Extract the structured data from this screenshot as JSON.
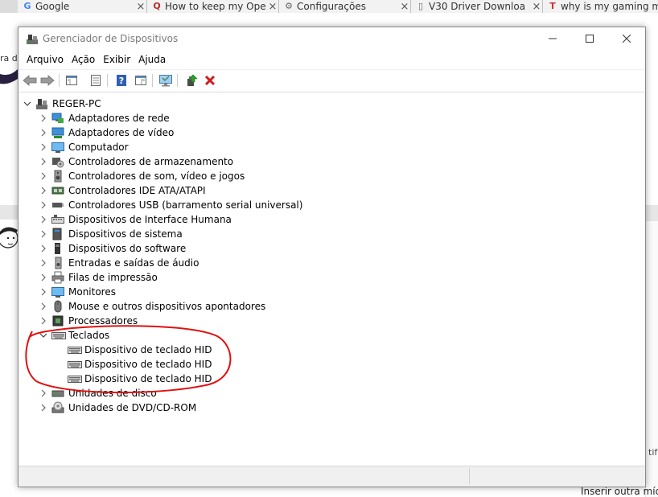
{
  "browser_tabs": [
    {
      "label": "Google",
      "icon": "google-icon"
    },
    {
      "label": "How to keep my Ope",
      "icon": "quora-icon"
    },
    {
      "label": "Configurações",
      "icon": "gear-icon"
    },
    {
      "label": "V30 Driver Downloa",
      "icon": "page-icon"
    },
    {
      "label": "why is my gaming m",
      "icon": "t-icon"
    }
  ],
  "background": {
    "left_text": "ra de",
    "right_text": "tif",
    "bottom_text": "Inserir outra mídia"
  },
  "window": {
    "title": "Gerenciador de Dispositivos",
    "minimize": "—",
    "maximize": "☐",
    "close": "✕"
  },
  "menu": [
    "Arquivo",
    "Ação",
    "Exibir",
    "Ajuda"
  ],
  "toolbar": [
    "back",
    "forward",
    "properties-view",
    "list-view",
    "help",
    "details-view",
    "monitor-scan",
    "update-driver",
    "uninstall"
  ],
  "tree": {
    "root": "REGER-PC",
    "categories": [
      {
        "label": "Adaptadores de rede",
        "icon": "network-adapter-icon"
      },
      {
        "label": "Adaptadores de vídeo",
        "icon": "display-adapter-icon"
      },
      {
        "label": "Computador",
        "icon": "computer-icon"
      },
      {
        "label": "Controladores de armazenamento",
        "icon": "storage-controller-icon"
      },
      {
        "label": "Controladores de som, vídeo e jogos",
        "icon": "speaker-icon"
      },
      {
        "label": "Controladores IDE ATA/ATAPI",
        "icon": "ide-controller-icon"
      },
      {
        "label": "Controladores USB (barramento serial universal)",
        "icon": "usb-icon"
      },
      {
        "label": "Dispositivos de Interface Humana",
        "icon": "hid-icon"
      },
      {
        "label": "Dispositivos de sistema",
        "icon": "system-device-icon"
      },
      {
        "label": "Dispositivos do software",
        "icon": "software-device-icon"
      },
      {
        "label": "Entradas e saídas de áudio",
        "icon": "audio-io-icon"
      },
      {
        "label": "Filas de impressão",
        "icon": "printer-icon"
      },
      {
        "label": "Monitores",
        "icon": "monitor-icon"
      },
      {
        "label": "Mouse e outros dispositivos apontadores",
        "icon": "mouse-icon"
      },
      {
        "label": "Processadores",
        "icon": "processor-icon"
      },
      {
        "label": "Teclados",
        "icon": "keyboard-icon",
        "expanded": true,
        "children": [
          "Dispositivo de teclado HID",
          "Dispositivo de teclado HID",
          "Dispositivo de teclado HID"
        ]
      },
      {
        "label": "Unidades de disco",
        "icon": "disk-drive-icon"
      },
      {
        "label": "Unidades de DVD/CD-ROM",
        "icon": "dvd-drive-icon"
      }
    ]
  },
  "annotation_color": "#e01010"
}
